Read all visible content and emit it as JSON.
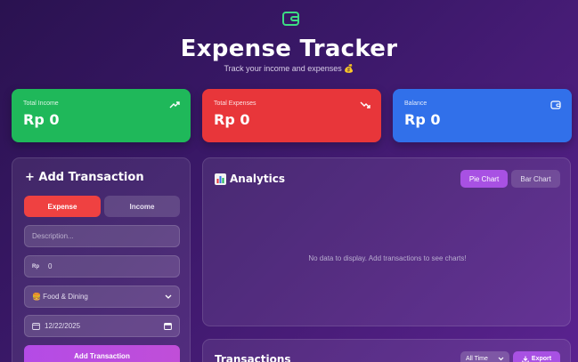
{
  "header": {
    "logo_icon": "wallet-icon",
    "title": "Expense Tracker",
    "subtitle": "Track your income and expenses 💰"
  },
  "summary": {
    "income": {
      "label": "Total Income",
      "value": "Rp 0",
      "icon": "trending-up-icon",
      "color": "#1fb85a"
    },
    "expenses": {
      "label": "Total Expenses",
      "value": "Rp 0",
      "icon": "trending-down-icon",
      "color": "#e8363a"
    },
    "balance": {
      "label": "Balance",
      "value": "Rp 0",
      "icon": "wallet-icon",
      "color": "#3170ea"
    }
  },
  "add_transaction": {
    "title": "+ Add Transaction",
    "type_expense": "Expense",
    "type_income": "Income",
    "description_placeholder": "Description...",
    "amount_prefix": "Rp",
    "amount_value": "0",
    "category_selected": "🍔 Food & Dining",
    "date_value": "12/22/2025",
    "submit_label": "Add Transaction"
  },
  "analytics": {
    "title": "Analytics",
    "tab_pie": "Pie Chart",
    "tab_bar": "Bar Chart",
    "empty_message": "No data to display. Add transactions to see charts!"
  },
  "transactions": {
    "title": "Transactions",
    "filter_selected": "All Time",
    "export_label": "Export"
  },
  "colors": {
    "accent": "#a851e3",
    "expense_red": "#ef4141"
  }
}
